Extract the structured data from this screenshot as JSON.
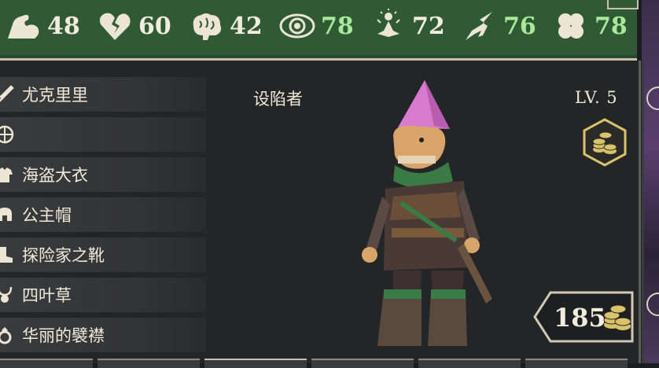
{
  "stats": [
    {
      "icon": "muscle-arm-icon",
      "value": "48",
      "color": "white"
    },
    {
      "icon": "broken-heart-icon",
      "value": "60",
      "color": "white"
    },
    {
      "icon": "brain-icon",
      "value": "42",
      "color": "white"
    },
    {
      "icon": "eye-icon",
      "value": "78",
      "color": "green"
    },
    {
      "icon": "meditation-figure-icon",
      "value": "72",
      "color": "white"
    },
    {
      "icon": "running-figure-icon",
      "value": "76",
      "color": "green"
    },
    {
      "icon": "four-leaf-clover-icon",
      "value": "78",
      "color": "green"
    }
  ],
  "equipment": [
    {
      "icon": "dagger-icon",
      "label": "尤克里里"
    },
    {
      "icon": "shield-icon",
      "label": ""
    },
    {
      "icon": "armor-icon",
      "label": "海盗大衣"
    },
    {
      "icon": "helmet-icon",
      "label": "公主帽"
    },
    {
      "icon": "boot-icon",
      "label": "探险家之靴"
    },
    {
      "icon": "amulet-icon",
      "label": "四叶草"
    },
    {
      "icon": "ring-icon",
      "label": "华丽的襞襟"
    }
  ],
  "character": {
    "class_name": "设陷者",
    "level": "LV. 5"
  },
  "gold": {
    "value": "185"
  },
  "colors": {
    "stats_bar": "#2f5a34",
    "stat_highlight": "#a9e79a",
    "panel_bg": "#242526",
    "coin_gold": "#d8c26a"
  }
}
